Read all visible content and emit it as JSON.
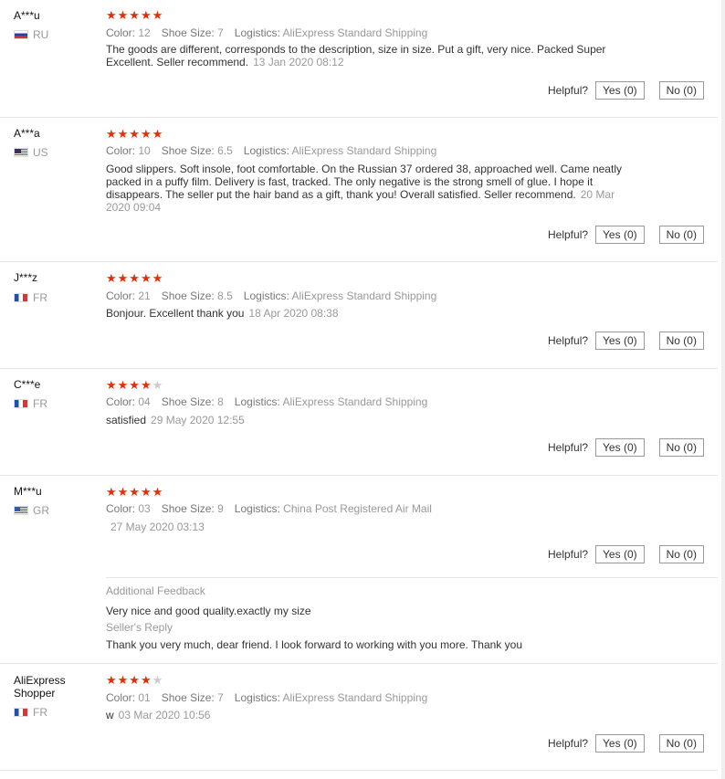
{
  "reviews": [
    {
      "user": "A***u",
      "country": "RU",
      "flag": "ru",
      "stars": 5,
      "color_label": "Color:",
      "color": "12",
      "size_label": "Shoe Size:",
      "size": "7",
      "logistics_label": "Logistics:",
      "logistics": "AliExpress Standard Shipping",
      "text": "The goods are different, corresponds to the description, size in size. Put a gift, very nice. Packed Super Excellent. Seller recommend.",
      "date": "13 Jan 2020 08:12",
      "helpful": "Helpful?",
      "yes": "Yes (0)",
      "no": "No (0)"
    },
    {
      "user": "A***a",
      "country": "US",
      "flag": "us",
      "stars": 5,
      "color_label": "Color:",
      "color": "10",
      "size_label": "Shoe Size:",
      "size": "6.5",
      "logistics_label": "Logistics:",
      "logistics": "AliExpress Standard Shipping",
      "text": "Good slippers. Soft insole, foot comfortable. On the Russian 37 ordered 38, approached well. Came neatly packed in a puffy film. Delivery is fast, tracked. The only negative is the strong smell of glue. I hope it disappears. The seller put the hair band as a gift, thank you! Overall satisfied. Seller recommend.",
      "date": "20 Mar 2020 09:04",
      "helpful": "Helpful?",
      "yes": "Yes (0)",
      "no": "No (0)"
    },
    {
      "user": "J***z",
      "country": "FR",
      "flag": "fr",
      "stars": 5,
      "color_label": "Color:",
      "color": "21",
      "size_label": "Shoe Size:",
      "size": "8.5",
      "logistics_label": "Logistics:",
      "logistics": "AliExpress Standard Shipping",
      "text": "Bonjour. Excellent thank you",
      "date": "18 Apr 2020 08:38",
      "helpful": "Helpful?",
      "yes": "Yes (0)",
      "no": "No (0)"
    },
    {
      "user": "C***e",
      "country": "FR",
      "flag": "fr",
      "stars": 4,
      "color_label": "Color:",
      "color": "04",
      "size_label": "Shoe Size:",
      "size": "8",
      "logistics_label": "Logistics:",
      "logistics": "AliExpress Standard Shipping",
      "text": "satisfied",
      "date": "29 May 2020 12:55",
      "helpful": "Helpful?",
      "yes": "Yes (0)",
      "no": "No (0)"
    },
    {
      "user": "M***u",
      "country": "GR",
      "flag": "gr",
      "stars": 5,
      "color_label": "Color:",
      "color": "03",
      "size_label": "Shoe Size:",
      "size": "9",
      "logistics_label": "Logistics:",
      "logistics": "China Post Registered Air Mail",
      "text": "",
      "date": "27 May 2020 03:13",
      "helpful": "Helpful?",
      "yes": "Yes (0)",
      "no": "No (0)",
      "additional_feedback_title": "Additional Feedback",
      "additional_feedback": "Very nice and good quality.exactly my size",
      "seller_reply_title": "Seller's Reply",
      "seller_reply": "Thank you very much, dear friend. I look forward to working with you more. Thank you"
    },
    {
      "user": "AliExpress Shopper",
      "country": "FR",
      "flag": "fr",
      "stars": 4,
      "color_label": "Color:",
      "color": "01",
      "size_label": "Shoe Size:",
      "size": "7",
      "logistics_label": "Logistics:",
      "logistics": "AliExpress Standard Shipping",
      "text": "w",
      "date": "03 Mar 2020 10:56",
      "helpful": "Helpful?",
      "yes": "Yes (0)",
      "no": "No (0)"
    }
  ]
}
